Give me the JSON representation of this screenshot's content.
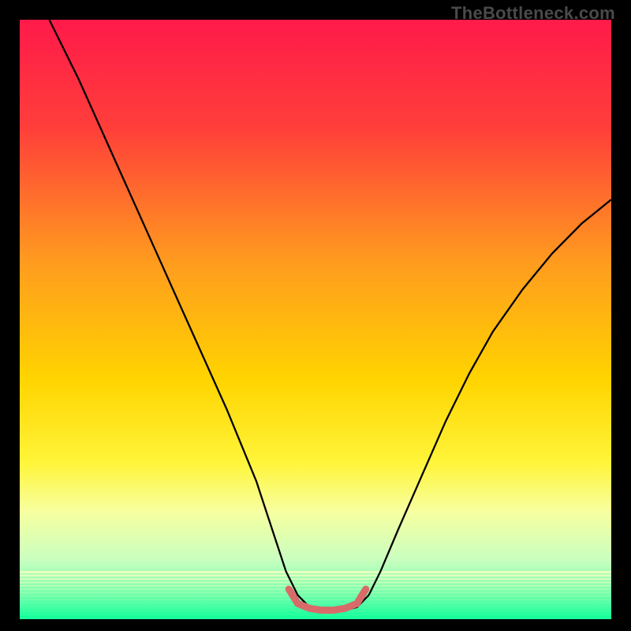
{
  "watermark": "TheBottleneck.com",
  "chart_data": {
    "type": "line",
    "title": "",
    "xlabel": "",
    "ylabel": "",
    "xlim": [
      0,
      100
    ],
    "ylim": [
      0,
      100
    ],
    "gradient_stops": [
      {
        "offset": 0,
        "color": "#ff1a4a"
      },
      {
        "offset": 18,
        "color": "#ff3e3a"
      },
      {
        "offset": 40,
        "color": "#ff9a1f"
      },
      {
        "offset": 60,
        "color": "#ffd400"
      },
      {
        "offset": 74,
        "color": "#fff53a"
      },
      {
        "offset": 82,
        "color": "#f7ffa0"
      },
      {
        "offset": 90,
        "color": "#caffbf"
      },
      {
        "offset": 95,
        "color": "#7fffb0"
      },
      {
        "offset": 100,
        "color": "#1bffa1"
      }
    ],
    "green_band": {
      "from": 92,
      "to": 100
    },
    "curve": {
      "x": [
        5,
        10,
        15,
        20,
        25,
        30,
        35,
        40,
        43,
        45,
        47,
        49,
        51,
        53,
        55,
        57,
        59,
        61,
        64,
        68,
        72,
        76,
        80,
        85,
        90,
        95,
        100
      ],
      "y": [
        100,
        90,
        79,
        68,
        57,
        46,
        35,
        23,
        14,
        8,
        4,
        2,
        1.5,
        1.5,
        1.5,
        2,
        4,
        8,
        15,
        24,
        33,
        41,
        48,
        55,
        61,
        66,
        70
      ]
    },
    "highlight_segment": {
      "x": [
        45.5,
        47,
        49,
        51,
        53,
        55,
        57,
        58.5
      ],
      "y": [
        5,
        2.6,
        1.8,
        1.5,
        1.5,
        1.8,
        2.6,
        5
      ],
      "color": "#d96a6a",
      "width": 9
    }
  }
}
